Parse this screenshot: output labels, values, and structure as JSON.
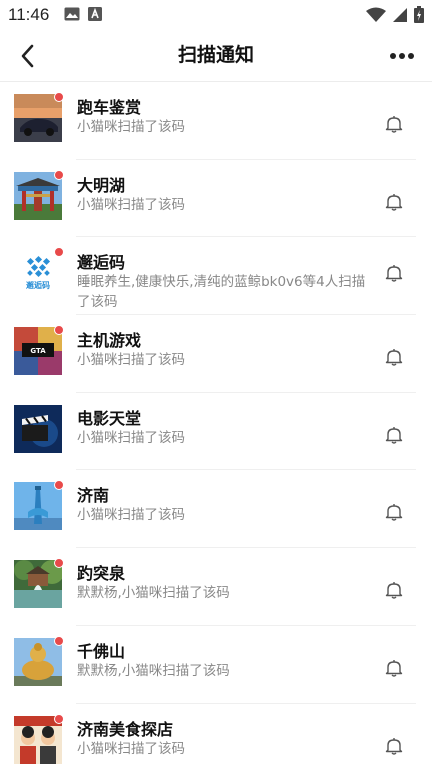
{
  "status_bar": {
    "time": "11:46"
  },
  "nav": {
    "title": "扫描通知"
  },
  "items": [
    {
      "title": "跑车鉴赏",
      "subtitle": "小猫咪扫描了该码",
      "thumb": "sports-car-photo"
    },
    {
      "title": "大明湖",
      "subtitle": "小猫咪扫描了该码",
      "thumb": "gate-archway-photo"
    },
    {
      "title": "邂逅码",
      "subtitle": "睡眠养生,健康快乐,清纯的蓝鲸bk0v6等4人扫描了该码",
      "thumb": "encounter-code-logo",
      "logo_text": "邂逅码"
    },
    {
      "title": "主机游戏",
      "subtitle": "小猫咪扫描了该码",
      "thumb": "game-cover-art"
    },
    {
      "title": "电影天堂",
      "subtitle": "小猫咪扫描了该码",
      "thumb": "film-clapper-art"
    },
    {
      "title": "济南",
      "subtitle": "小猫咪扫描了该码",
      "thumb": "monument-photo"
    },
    {
      "title": "趵突泉",
      "subtitle": "默默杨,小猫咪扫描了该码",
      "thumb": "spring-garden-photo"
    },
    {
      "title": "千佛山",
      "subtitle": "默默杨,小猫咪扫描了该码",
      "thumb": "buddha-statue-photo"
    },
    {
      "title": "济南美食探店",
      "subtitle": "小猫咪扫描了该码",
      "thumb": "food-cartoon-art"
    }
  ]
}
